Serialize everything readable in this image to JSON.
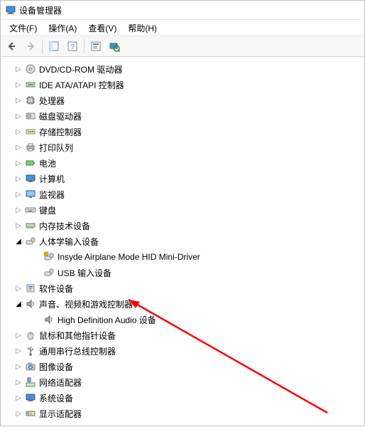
{
  "window": {
    "title": "设备管理器"
  },
  "menu": {
    "file": "文件(F)",
    "action": "操作(A)",
    "view": "查看(V)",
    "help": "帮助(H)"
  },
  "nodes": {
    "dvd": "DVD/CD-ROM 驱动器",
    "ide": "IDE ATA/ATAPI 控制器",
    "cpu": "处理器",
    "disk": "磁盘驱动器",
    "storage": "存储控制器",
    "print": "打印队列",
    "battery": "电池",
    "computer": "计算机",
    "monitor": "监视器",
    "keyboard": "键盘",
    "memtech": "内存技术设备",
    "hid": "人体学输入设备",
    "hid_air": "Insyde Airplane Mode HID Mini-Driver",
    "hid_usb": "USB 输入设备",
    "softdev": "软件设备",
    "sound": "声音、视频和游戏控制器",
    "sound_hd": "High Definition Audio 设备",
    "mouse": "鼠标和其他指针设备",
    "usb": "通用串行总线控制器",
    "imaging": "图像设备",
    "network": "网络适配器",
    "system": "系统设备",
    "display": "显示适配器"
  }
}
